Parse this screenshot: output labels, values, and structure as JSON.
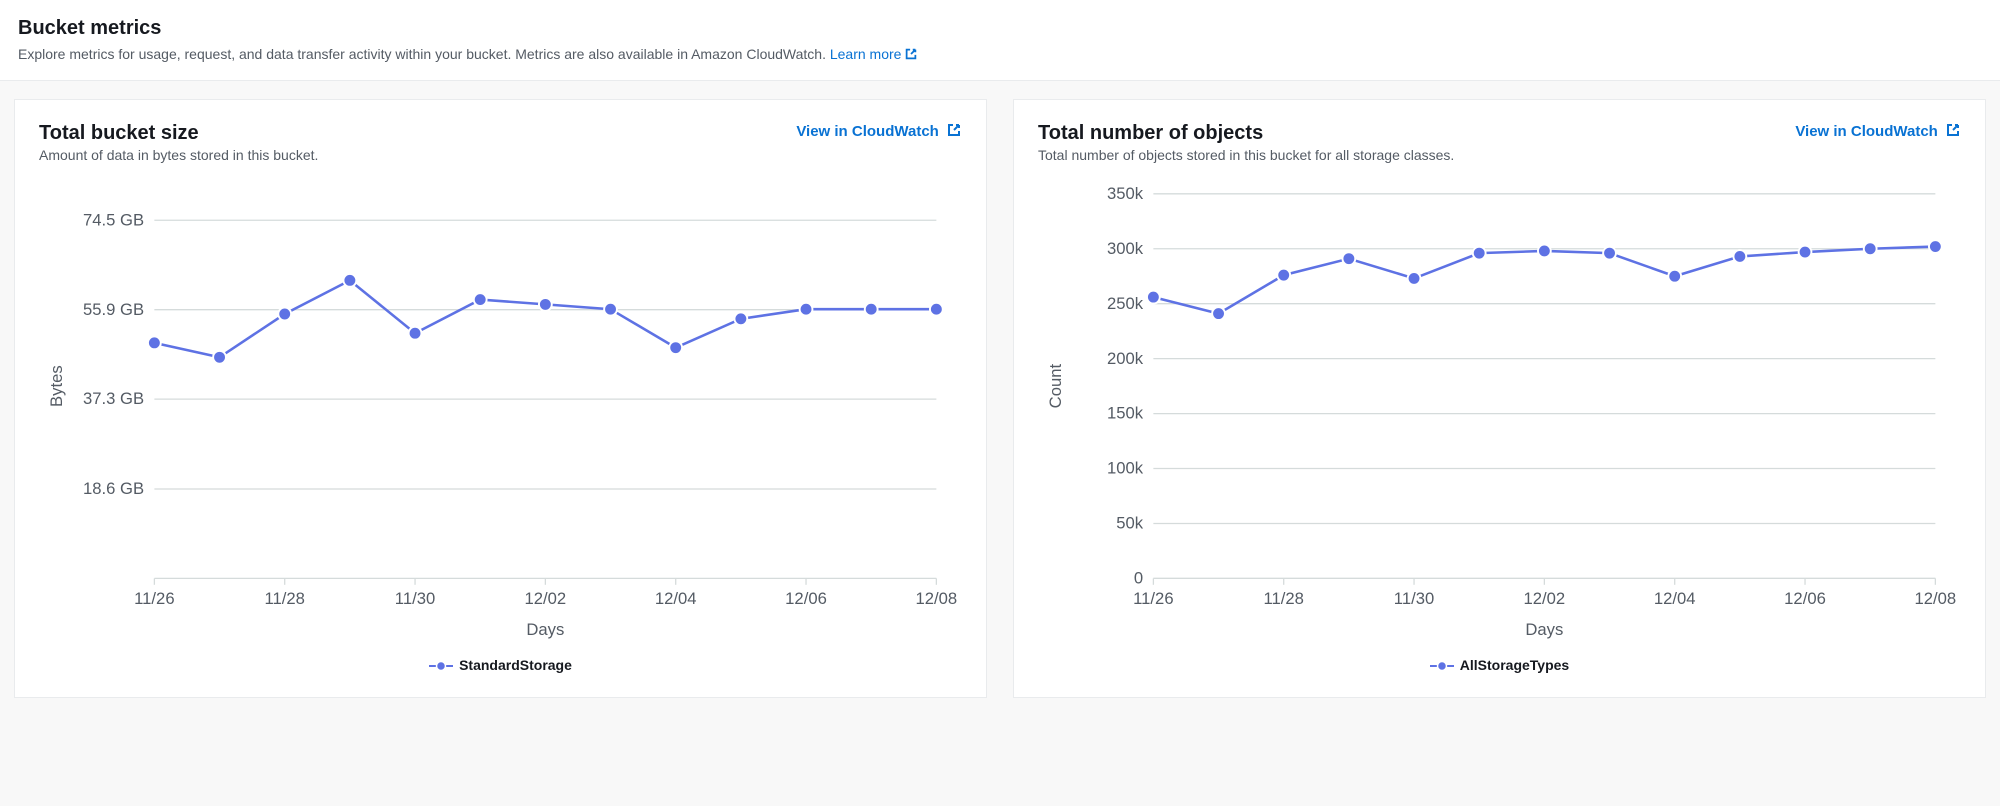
{
  "header": {
    "title": "Bucket metrics",
    "subtitle": "Explore metrics for usage, request, and data transfer activity within your bucket. Metrics are also available in Amazon CloudWatch. ",
    "learn_more": "Learn more"
  },
  "panels": {
    "size": {
      "title": "Total bucket size",
      "subtitle": "Amount of data in bytes stored in this bucket.",
      "view_link": "View in CloudWatch"
    },
    "objects": {
      "title": "Total number of objects",
      "subtitle": "Total number of objects stored in this bucket for all storage classes.",
      "view_link": "View in CloudWatch"
    }
  },
  "chart_data": [
    {
      "id": "size",
      "type": "line",
      "title": "Total bucket size",
      "xlabel": "Days",
      "ylabel": "Bytes",
      "x_ticks": [
        "11/26",
        "11/28",
        "11/30",
        "12/02",
        "12/04",
        "12/06",
        "12/08"
      ],
      "y_ticks_labels": [
        "18.6 GB",
        "37.3 GB",
        "55.9 GB",
        "74.5 GB"
      ],
      "y_ticks_values": [
        18.6,
        37.3,
        55.9,
        74.5
      ],
      "ylim": [
        0,
        80
      ],
      "categories": [
        "11/26",
        "11/27",
        "11/28",
        "11/29",
        "11/30",
        "12/01",
        "12/02",
        "12/03",
        "12/04",
        "12/05",
        "12/06",
        "12/07",
        "12/08"
      ],
      "series": [
        {
          "name": "StandardStorage",
          "values": [
            49,
            46,
            55,
            62,
            51,
            58,
            57,
            56,
            48,
            54,
            56,
            56,
            56
          ]
        }
      ],
      "legend": "StandardStorage"
    },
    {
      "id": "objects",
      "type": "line",
      "title": "Total number of objects",
      "xlabel": "Days",
      "ylabel": "Count",
      "x_ticks": [
        "11/26",
        "11/28",
        "11/30",
        "12/02",
        "12/04",
        "12/06",
        "12/08"
      ],
      "y_ticks_labels": [
        "0",
        "50k",
        "100k",
        "150k",
        "200k",
        "250k",
        "300k",
        "350k"
      ],
      "y_ticks_values": [
        0,
        50000,
        100000,
        150000,
        200000,
        250000,
        300000,
        350000
      ],
      "ylim": [
        0,
        350000
      ],
      "categories": [
        "11/26",
        "11/27",
        "11/28",
        "11/29",
        "11/30",
        "12/01",
        "12/02",
        "12/03",
        "12/04",
        "12/05",
        "12/06",
        "12/07",
        "12/08"
      ],
      "series": [
        {
          "name": "AllStorageTypes",
          "values": [
            256000,
            241000,
            276000,
            291000,
            273000,
            296000,
            298000,
            296000,
            275000,
            293000,
            297000,
            300000,
            302000
          ]
        }
      ],
      "legend": "AllStorageTypes"
    }
  ]
}
